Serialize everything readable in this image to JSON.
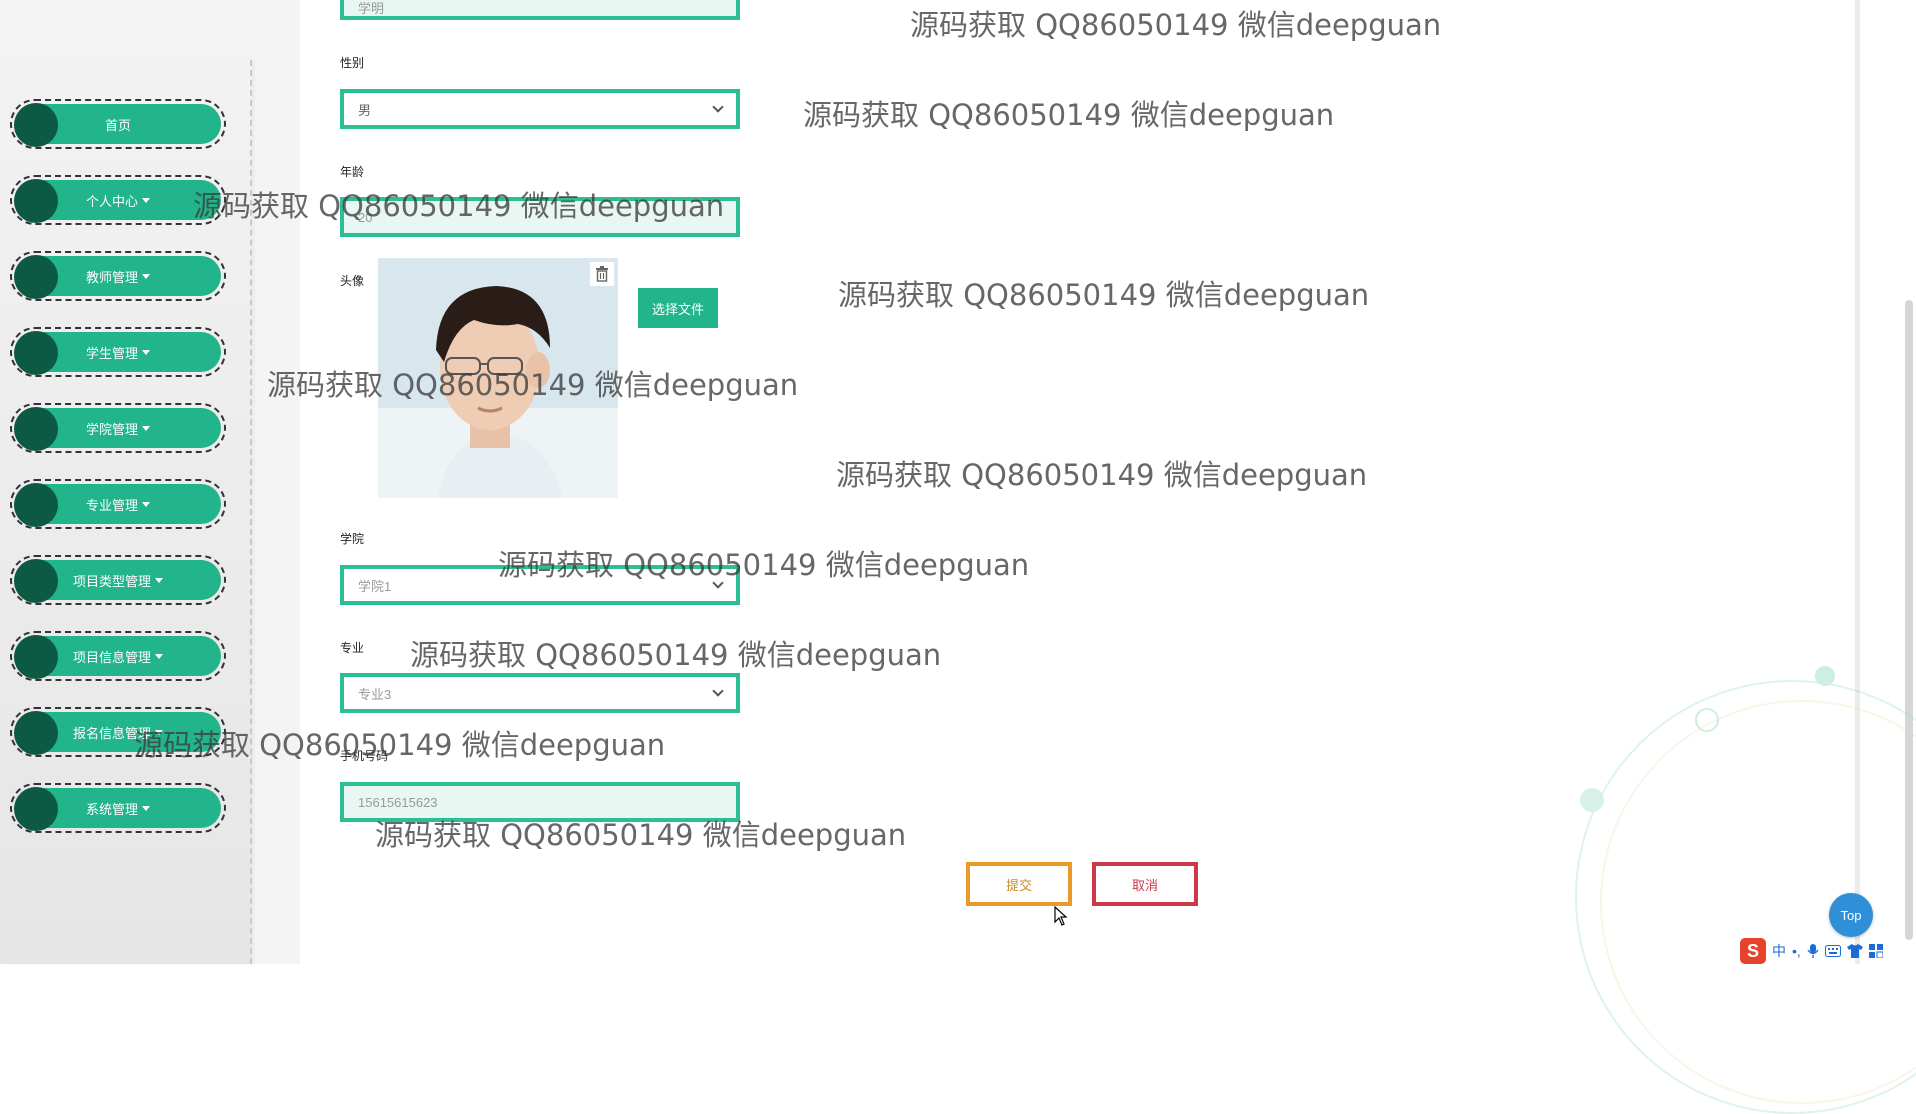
{
  "sidebar": {
    "items": [
      {
        "label": "首页",
        "has_dropdown": false
      },
      {
        "label": "个人中心",
        "has_dropdown": true
      },
      {
        "label": "教师管理",
        "has_dropdown": true
      },
      {
        "label": "学生管理",
        "has_dropdown": true
      },
      {
        "label": "学院管理",
        "has_dropdown": true
      },
      {
        "label": "专业管理",
        "has_dropdown": true
      },
      {
        "label": "项目类型管理",
        "has_dropdown": true
      },
      {
        "label": "项目信息管理",
        "has_dropdown": true
      },
      {
        "label": "报名信息管理",
        "has_dropdown": true
      },
      {
        "label": "系统管理",
        "has_dropdown": true
      }
    ]
  },
  "form": {
    "partial_top_value": "学明",
    "gender_label": "性别",
    "gender_value": "男",
    "age_label": "年龄",
    "age_value": "20",
    "avatar_label": "头像",
    "choose_file_label": "选择文件",
    "college_label": "学院",
    "college_value": "学院1",
    "major_label": "专业",
    "major_value": "专业3",
    "phone_label": "手机号码",
    "phone_value": "15615615623",
    "submit_label": "提交",
    "cancel_label": "取消"
  },
  "top_button_label": "Top",
  "watermarks": {
    "text": "源码获取 QQ86050149 微信deepguan"
  },
  "taskbar": {
    "ime_logo": "S",
    "ime_lang": "中",
    "ime_punct": "•,",
    "icons": [
      "microphone-icon",
      "keyboard-icon",
      "shirt-icon",
      "grid-icon"
    ]
  },
  "colors": {
    "accent": "#22b48a",
    "field_border": "#2cbf96",
    "submit": "#e89b27",
    "cancel": "#cc3a4a",
    "top_button": "#2f8fd8"
  }
}
